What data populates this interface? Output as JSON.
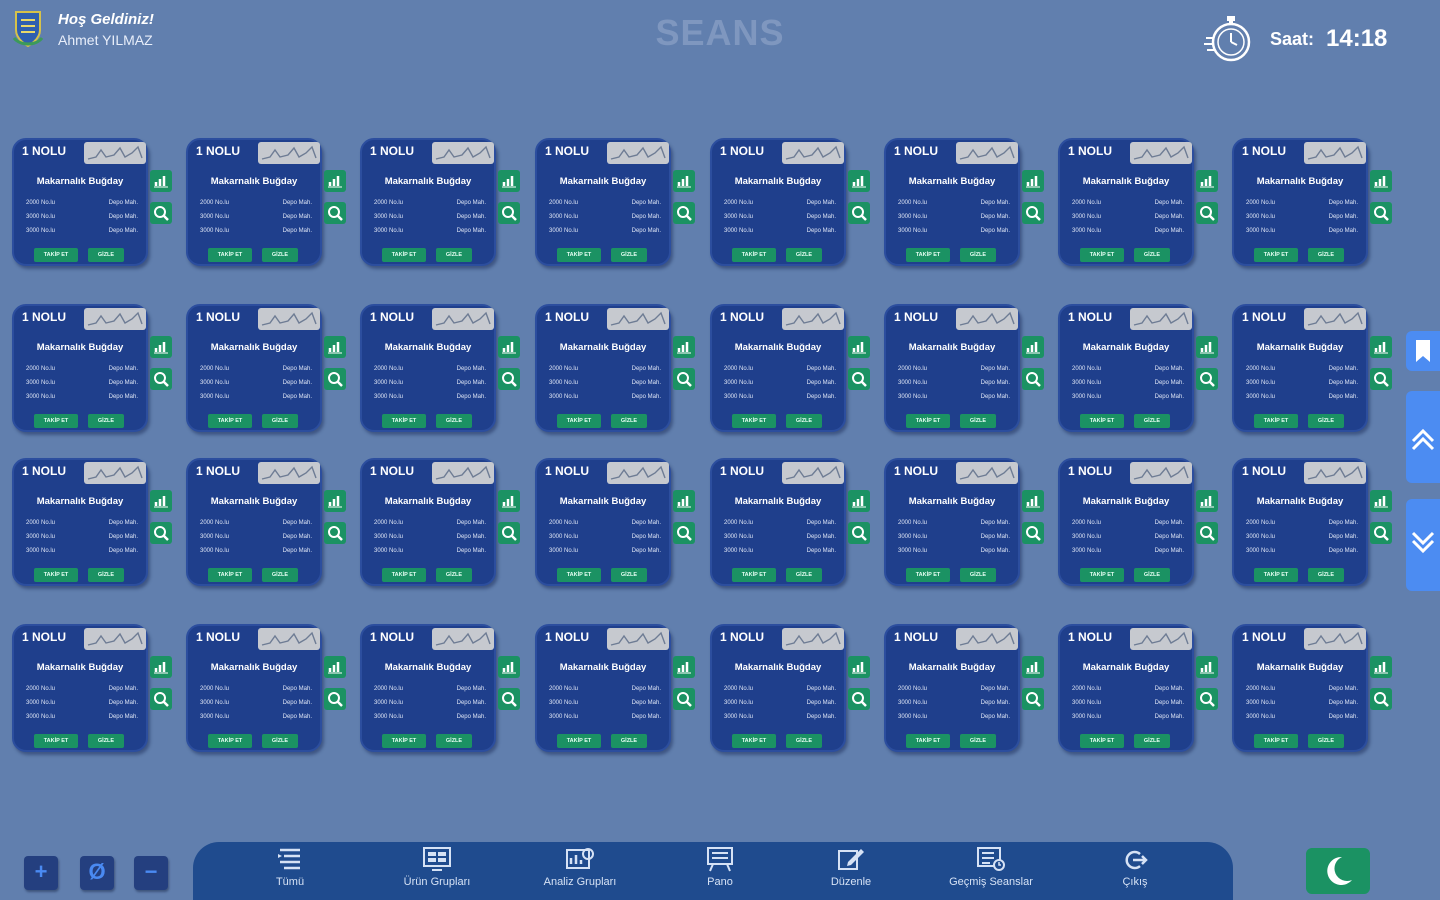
{
  "header": {
    "welcome": "Hoş Geldiniz!",
    "user": "Ahmet YILMAZ",
    "title": "SEANS",
    "time_label": "Saat:",
    "time": "14:18"
  },
  "card_template": {
    "number_label": "1 NOLU",
    "product": "Makarnalık Buğday",
    "rows": [
      {
        "left": "2000 No.lu",
        "right": "Depo Mah."
      },
      {
        "left": "3000 No.lu",
        "right": "Depo Mah."
      },
      {
        "left": "3000 No.lu",
        "right": "Depo Mah."
      }
    ],
    "follow_label": "TAKİP ET",
    "hide_label": "GİZLE"
  },
  "grid": {
    "rows": 4,
    "cols": 8
  },
  "bottom_nav": [
    {
      "label": "Tümü",
      "icon": "list-icon"
    },
    {
      "label": "Ürün Grupları",
      "icon": "product-groups-icon"
    },
    {
      "label": "Analiz Grupları",
      "icon": "analysis-groups-icon"
    },
    {
      "label": "Pano",
      "icon": "board-icon"
    },
    {
      "label": "Düzenle",
      "icon": "edit-icon"
    },
    {
      "label": "Geçmiş Seanslar",
      "icon": "history-icon"
    },
    {
      "label": "Çıkış",
      "icon": "logout-icon"
    }
  ],
  "zoom": {
    "in": "+",
    "reset": "Ø",
    "out": "−"
  },
  "colors": {
    "background": "#617fae",
    "card": "#1f3f8c",
    "accent_green": "#1b9263",
    "sidebar_blue": "#4c8cf2",
    "nav_bar": "#1f4b8e"
  }
}
